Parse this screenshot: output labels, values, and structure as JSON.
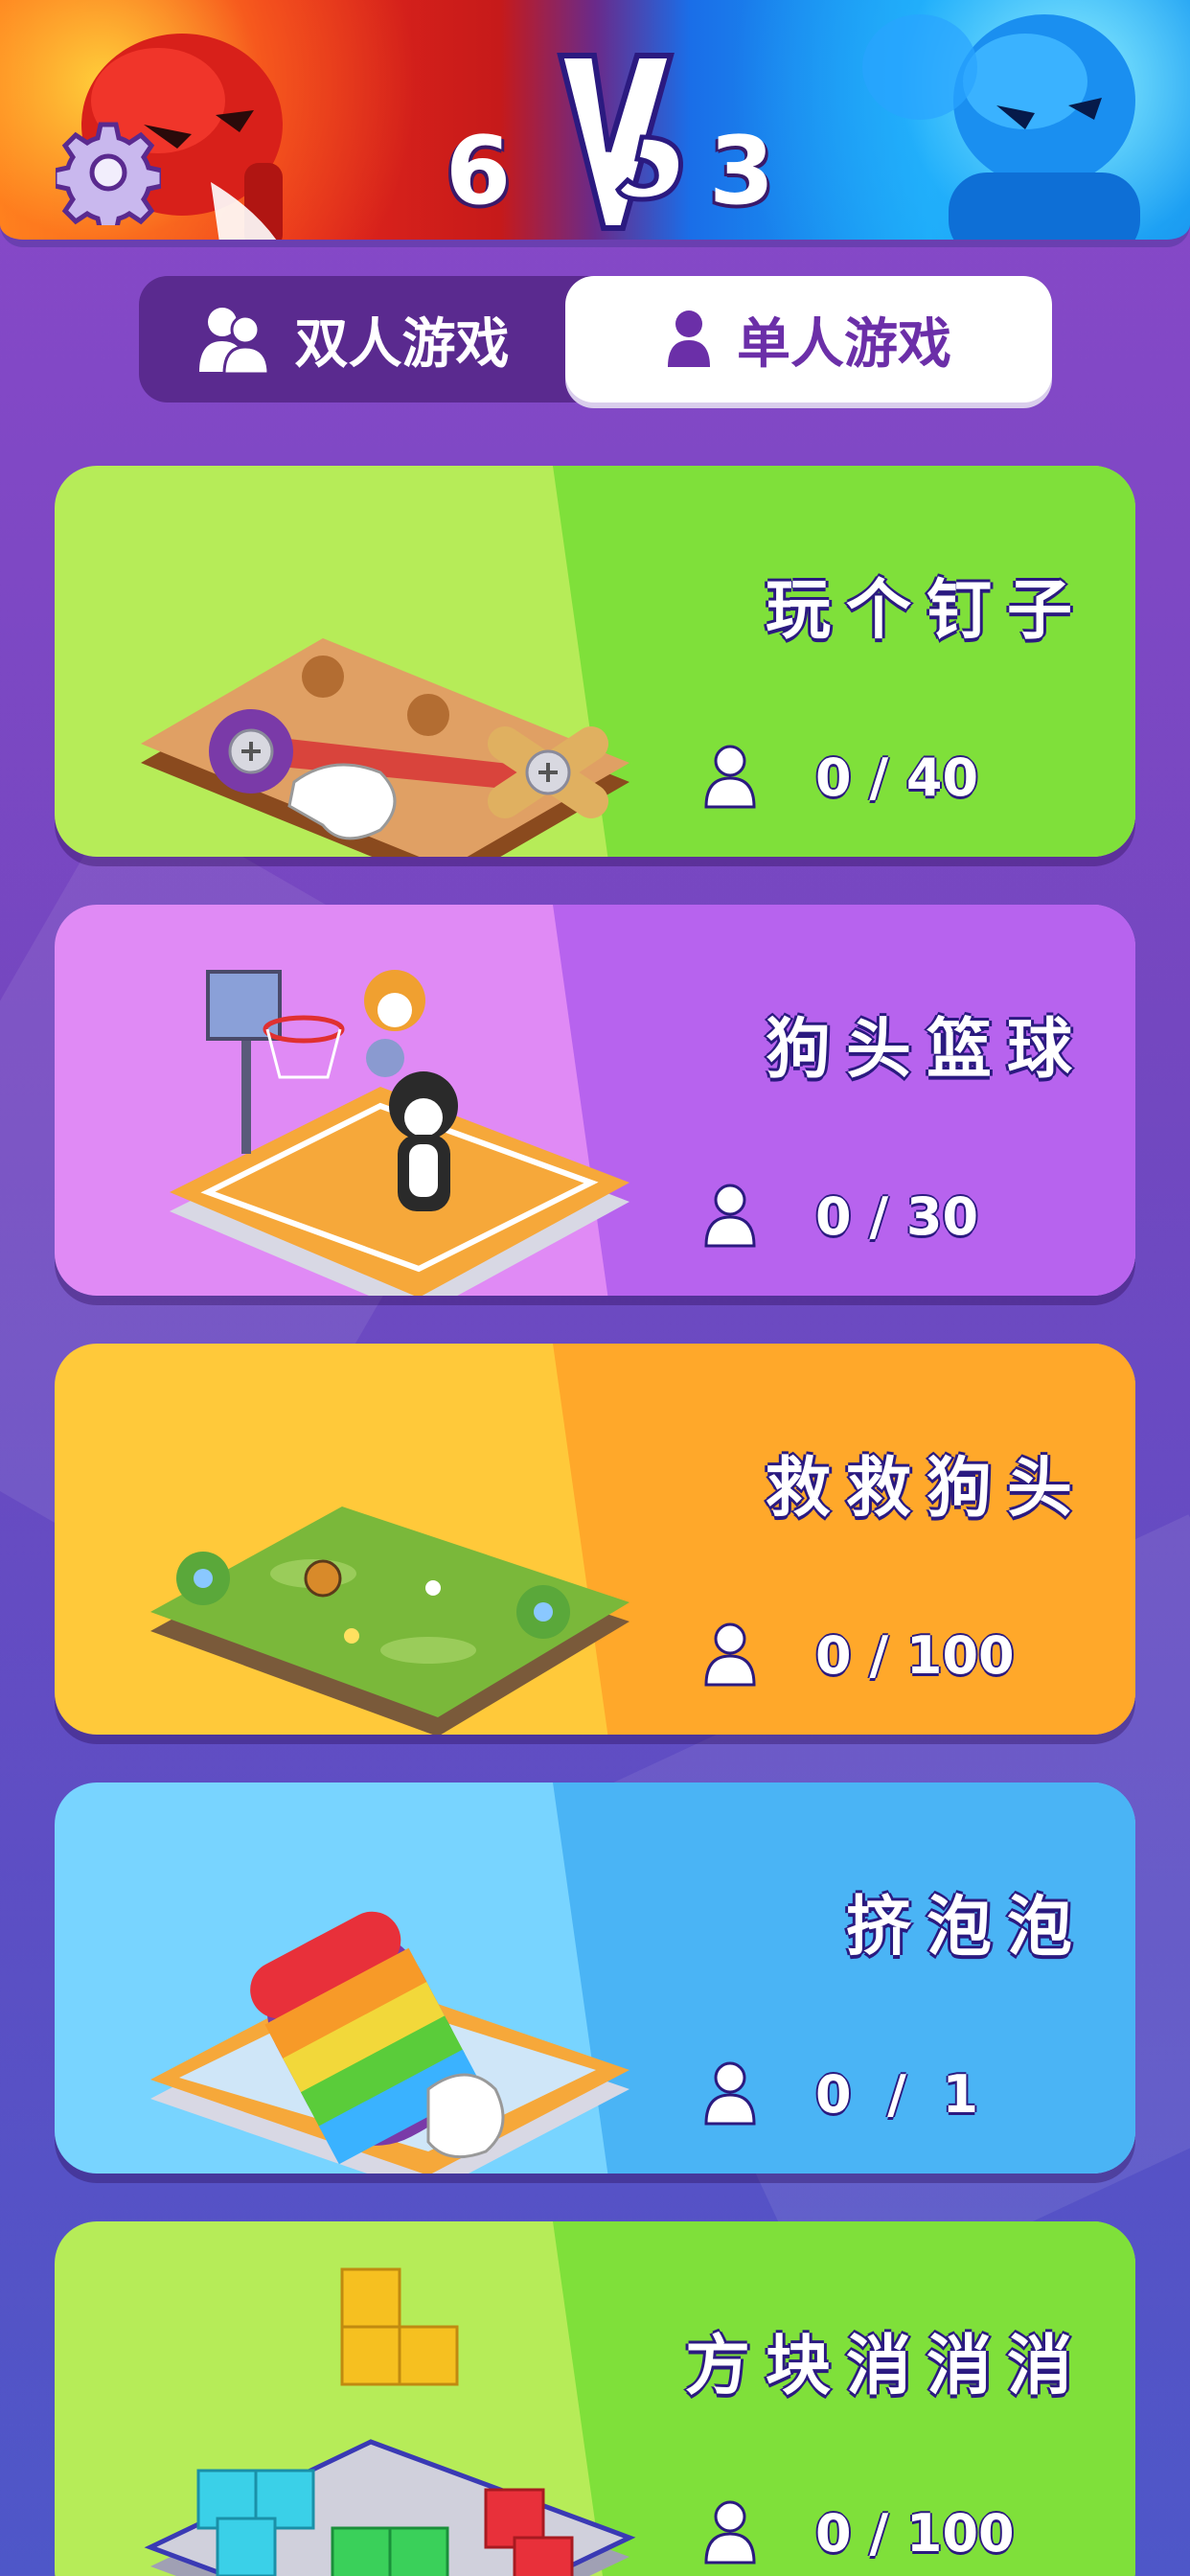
{
  "header": {
    "score_left": "6",
    "score_right": "3",
    "vs_label": "VS",
    "colors": {
      "red_team": "#e8281c",
      "blue_team": "#17a8f5"
    }
  },
  "mode_tabs": {
    "two_player": "双人游戏",
    "single_player": "单人游戏",
    "selected": "single_player"
  },
  "games": [
    {
      "title": "玩个钉子",
      "progress": "0 / 40",
      "color_left": "#b6ec58",
      "color_right": "#7fe03a",
      "icon": "wooden-board-screw-icon"
    },
    {
      "title": "狗头篮球",
      "progress": "0 / 30",
      "color_left": "#e08af5",
      "color_right": "#b763ee",
      "icon": "basketball-court-dogs-icon"
    },
    {
      "title": "救救狗头",
      "progress": "0 / 100",
      "color_left": "#ffc93a",
      "color_right": "#ffa82a",
      "icon": "grass-field-icon"
    },
    {
      "title": "挤泡泡",
      "progress": "0  /  1",
      "color_left": "#78d4ff",
      "color_right": "#4ab4f5",
      "icon": "pop-it-toy-icon"
    },
    {
      "title": "方块消消消",
      "progress": "0 / 100",
      "color_left": "#b6ec58",
      "color_right": "#7fe03a",
      "icon": "block-puzzle-icon"
    }
  ]
}
